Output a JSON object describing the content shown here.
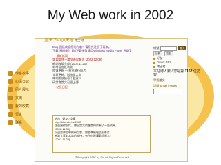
{
  "slide": {
    "title": "My Web work in 2002"
  },
  "site": {
    "logo": "蓝天下の小天地",
    "logo_sub": "博士村",
    "nav_items": [
      "博客故事",
      "心情日记",
      "图片展示",
      "文摘",
      "我的收藏",
      "留言",
      "联系"
    ],
    "notices": [
      "Blog 团队欢迎您的光临！请您先注册了再来。",
      "下载 [播放器] 【如下载失败请用Windows Media Player 升级】"
    ],
    "section1_head": "— 最新新闻",
    "news": [
      {
        "text": "第12號博士論文進度報告 (2002.12.09)",
        "highlight": true
      },
      {
        "text": "網站改版完成 (2002.11.20)",
        "highlight": false
      },
      {
        "text": "新增留言板功能",
        "highlight": false
      },
      {
        "text": "相簿更新 — 秋季旅行照片",
        "highlight": false
      },
      {
        "text": "文章更新：科技與人文",
        "highlight": false
      },
      {
        "text": "本站開放訪客下載資料",
        "highlight": false
      },
      {
        "text": "研討會論文已經上傳",
        "highlight": false
      }
    ],
    "section2_head": "— 站長日記",
    "message_lines": [
      "站內 / 好友 / 文章",
      "http://bluesky.tw/2002",
      "這週過得很忙，博士論文的進度終於有了一些成果。",
      "(2002.11.30)",
      "下週要參加學術研討會，需要準備報告投影片。",
      "感謝大家對本站的支持，有任何建議歡迎留言！",
      "(2002.11.25)"
    ],
    "footer": "©Copyright 2002 by Shi All Rights Reserved",
    "right": {
      "login_label": "帳號",
      "login_button": "登入",
      "sub_buttons": [
        "註冊",
        "忘記"
      ],
      "links": [
        "好友",
        "Dino's BBS",
        "博士村"
      ],
      "counter_label": "本站總人數 / 您是第",
      "counter_value": "1162",
      "counter_suffix": "位訪客",
      "extra_link": "學術論文",
      "subscribe_label": "訂閱 Email / News!"
    }
  }
}
